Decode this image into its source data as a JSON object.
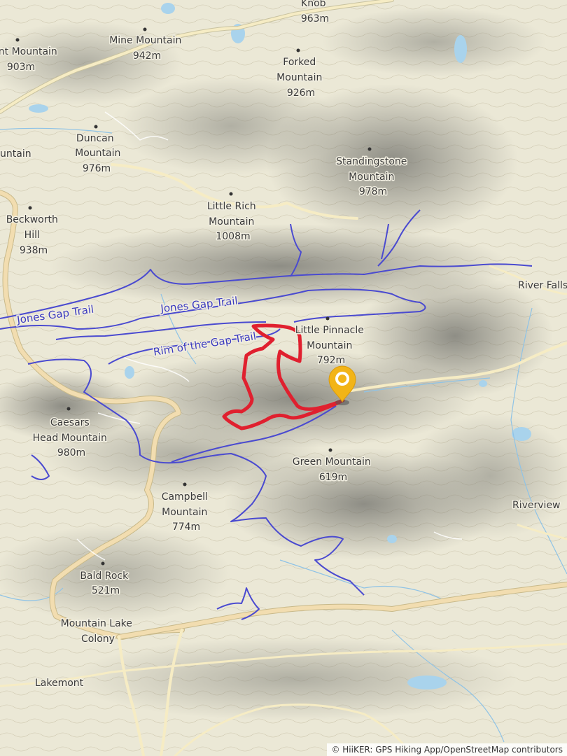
{
  "map": {
    "peaks": [
      {
        "id": "knob",
        "lines": [
          "Knob",
          "963m"
        ]
      },
      {
        "id": "mine",
        "lines": [
          "Mine Mountain",
          "942m"
        ]
      },
      {
        "id": "nt",
        "lines": [
          "nt Mountain",
          "903m"
        ]
      },
      {
        "id": "forked",
        "lines": [
          "Forked",
          "Mountain",
          "926m"
        ]
      },
      {
        "id": "duncan",
        "lines": [
          "Duncan",
          "Mountain",
          "976m"
        ]
      },
      {
        "id": "untain",
        "lines": [
          "untain"
        ]
      },
      {
        "id": "standingstone",
        "lines": [
          "Standingstone",
          "Mountain",
          "978m"
        ]
      },
      {
        "id": "beckworth",
        "lines": [
          "Beckworth",
          "Hill",
          "938m"
        ]
      },
      {
        "id": "littlerich",
        "lines": [
          "Little Rich",
          "Mountain",
          "1008m"
        ]
      },
      {
        "id": "littlepinnacle",
        "lines": [
          "Little Pinnacle",
          "Mountain",
          "792m"
        ]
      },
      {
        "id": "caesars",
        "lines": [
          "Caesars",
          "Head Mountain",
          "980m"
        ]
      },
      {
        "id": "green",
        "lines": [
          "Green Mountain",
          "619m"
        ]
      },
      {
        "id": "campbell",
        "lines": [
          "Campbell",
          "Mountain",
          "774m"
        ]
      },
      {
        "id": "baldrock",
        "lines": [
          "Bald Rock",
          "521m"
        ]
      }
    ],
    "places": [
      {
        "id": "riverfalls",
        "label": "River Falls"
      },
      {
        "id": "riverview",
        "label": "Riverview"
      },
      {
        "id": "mountainlake",
        "lines": [
          "Mountain Lake",
          "Colony"
        ]
      },
      {
        "id": "lakemont",
        "label": "Lakemont"
      }
    ],
    "trails": [
      {
        "id": "jones1",
        "label": "Jones Gap Trail"
      },
      {
        "id": "jones2",
        "label": "Jones Gap Trail"
      },
      {
        "id": "rim",
        "label": "Rim of the Gap Trail"
      }
    ],
    "colors": {
      "route": "#e0202f",
      "trail": "#4a4ad0",
      "road": "#f3e3b0",
      "water": "#a9d3ec",
      "marker": "#f2b417"
    },
    "marker_icon": "location-pin-icon"
  },
  "attribution": "© HiiKER: GPS Hiking App/OpenStreetMap contributors"
}
